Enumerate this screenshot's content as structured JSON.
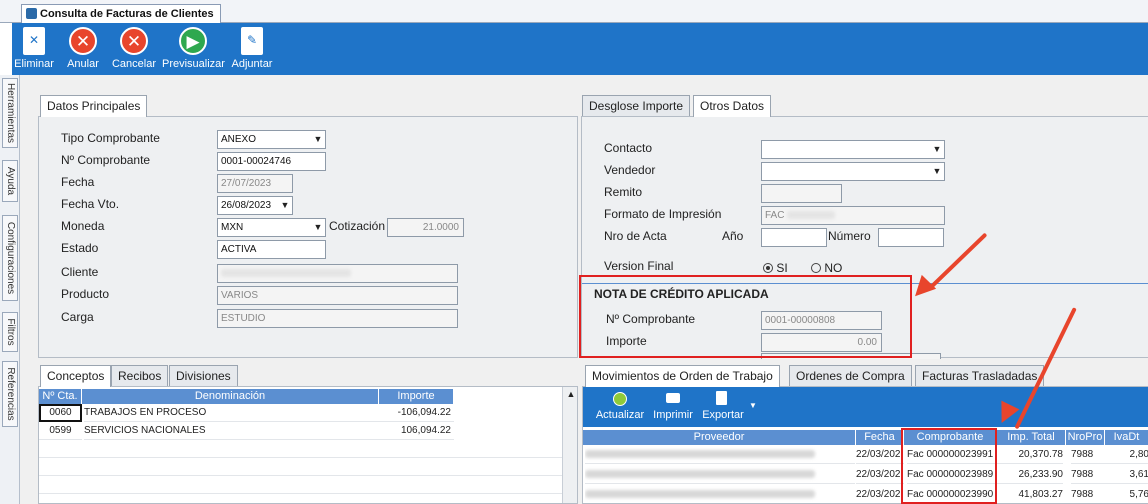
{
  "window": {
    "tab_title": "Consulta de Facturas de Clientes"
  },
  "toolbar": {
    "eliminar": "Eliminar",
    "anular": "Anular",
    "cancelar": "Cancelar",
    "previsualizar": "Previsualizar",
    "adjuntar": "Adjuntar"
  },
  "sidebar": {
    "herramientas": "Herramientas",
    "ayuda": "Ayuda",
    "configuraciones": "Configuraciones",
    "filtros": "Filtros",
    "referencias": "Referencias"
  },
  "datos": {
    "tab": "Datos Principales",
    "tipo_label": "Tipo Comprobante",
    "tipo_value": "ANEXO",
    "nro_label": "Nº Comprobante",
    "nro_value": "0001-00024746",
    "fecha_label": "Fecha",
    "fecha_value": "27/07/2023",
    "vto_label": "Fecha Vto.",
    "vto_value": "26/08/2023",
    "moneda_label": "Moneda",
    "moneda_value": "MXN",
    "cotizacion_label": "Cotización",
    "cotizacion_value": "21.0000",
    "estado_label": "Estado",
    "estado_value": "ACTIVA",
    "cliente_label": "Cliente",
    "producto_label": "Producto",
    "producto_value": "VARIOS",
    "carga_label": "Carga",
    "carga_value": "ESTUDIO"
  },
  "otros": {
    "tab_desglose": "Desglose Importe",
    "tab_otros": "Otros Datos",
    "contacto_label": "Contacto",
    "vendedor_label": "Vendedor",
    "remito_label": "Remito",
    "formato_label": "Formato de Impresión",
    "formato_value": "FAC",
    "acta_label": "Nro de Acta",
    "anio_label": "Año",
    "numero_label": "Número",
    "version_label": "Version Final",
    "si": "SI",
    "no": "NO",
    "nc_title": "NOTA DE CRÉDITO APLICADA",
    "nc_nro_label": "Nº Comprobante",
    "nc_nro_value": "0001-00000808",
    "nc_importe_label": "Importe",
    "nc_importe_value": "0.00"
  },
  "conceptos": {
    "tabs": [
      "Conceptos",
      "Recibos",
      "Divisiones"
    ],
    "headers": [
      "Nº Cta.",
      "Denominación",
      "Importe"
    ],
    "rows": [
      {
        "cta": "0060",
        "den": "TRABAJOS EN PROCESO",
        "imp": "-106,094.22"
      },
      {
        "cta": "0599",
        "den": "SERVICIOS NACIONALES",
        "imp": "106,094.22"
      }
    ]
  },
  "movimientos": {
    "tabs": [
      "Movimientos de Orden de Trabajo",
      "Ordenes de Compra",
      "Facturas Trasladadas"
    ],
    "actualizar": "Actualizar",
    "imprimir": "Imprimir",
    "exportar": "Exportar",
    "headers": [
      "Proveedor",
      "Fecha",
      "Comprobante",
      "Imp. Total",
      "NroPro",
      "IvaDt"
    ],
    "rows": [
      {
        "fecha": "22/03/202",
        "comp": "Fac 000000023991",
        "imp": "20,370.78",
        "nro": "7988",
        "iva": "2,80"
      },
      {
        "fecha": "22/03/202",
        "comp": "Fac 000000023989",
        "imp": "26,233.90",
        "nro": "7988",
        "iva": "3,61"
      },
      {
        "fecha": "22/03/202",
        "comp": "Fac 000000023990",
        "imp": "41,803.27",
        "nro": "7988",
        "iva": "5,76"
      }
    ]
  },
  "colors": {
    "toolbar": "#1f74c8",
    "header": "#5b8fd1",
    "highlight": "#e02020"
  }
}
